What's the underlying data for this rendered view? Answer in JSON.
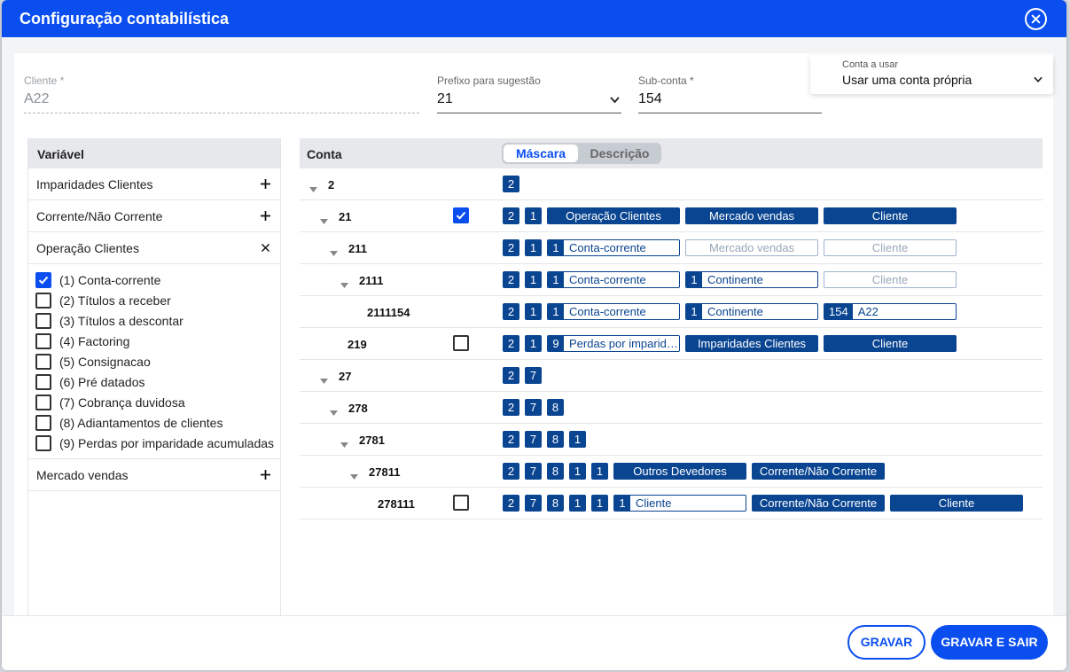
{
  "modal": {
    "title": "Configuração contabilística",
    "close_icon": "close-icon"
  },
  "form": {
    "cliente": {
      "label": "Cliente *",
      "value": "A22"
    },
    "prefixo": {
      "label": "Prefixo para sugestão",
      "value": "21"
    },
    "subconta": {
      "label": "Sub-conta *",
      "value": "154"
    },
    "conta_usar": {
      "label": "Conta a usar",
      "value": "Usar uma conta própria"
    }
  },
  "left": {
    "header": "Variável",
    "groups": [
      {
        "label": "Imparidades Clientes",
        "toggle": "+"
      },
      {
        "label": "Corrente/Não Corrente",
        "toggle": "+"
      },
      {
        "label": "Operação Clientes",
        "toggle": "×"
      },
      {
        "label": "Mercado vendas",
        "toggle": "+"
      }
    ],
    "options": [
      {
        "label": "(1) Conta-corrente",
        "checked": true
      },
      {
        "label": "(2) Títulos a receber",
        "checked": false
      },
      {
        "label": "(3) Títulos a descontar",
        "checked": false
      },
      {
        "label": "(4) Factoring",
        "checked": false
      },
      {
        "label": "(5) Consignacao",
        "checked": false
      },
      {
        "label": "(6) Pré datados",
        "checked": false
      },
      {
        "label": "(7) Cobrança duvidosa",
        "checked": false
      },
      {
        "label": "(8) Adiantamentos de clientes",
        "checked": false
      },
      {
        "label": "(9) Perdas por imparidade acumuladas",
        "checked": false
      }
    ]
  },
  "right": {
    "header": "Conta",
    "toggle": {
      "mascara": "Máscara",
      "descricao": "Descrição"
    },
    "rows": [
      {
        "code": "2",
        "digits": [
          "2"
        ],
        "tags": []
      },
      {
        "code": "21",
        "checkbox": true,
        "digits": [
          "2",
          "1"
        ],
        "tags": [
          "Operação Clientes",
          "Mercado vendas",
          "Cliente"
        ]
      },
      {
        "code": "211",
        "digits": [
          "2",
          "1"
        ],
        "inputs": [
          {
            "pre": "1",
            "text": "Conta-corrente"
          }
        ],
        "pale": [
          "Mercado vendas",
          "Cliente"
        ]
      },
      {
        "code": "2111",
        "digits": [
          "2",
          "1"
        ],
        "inputs": [
          {
            "pre": "1",
            "text": "Conta-corrente"
          },
          {
            "pre": "1",
            "text": "Continente"
          }
        ],
        "pale": [
          "Cliente"
        ]
      },
      {
        "code": "2111154",
        "digits": [
          "2",
          "1"
        ],
        "inputs": [
          {
            "pre": "1",
            "text": "Conta-corrente"
          },
          {
            "pre": "1",
            "text": "Continente"
          },
          {
            "pre": "154",
            "text": "A22"
          }
        ]
      },
      {
        "code": "219",
        "checkbox": false,
        "digits": [
          "2",
          "1"
        ],
        "inputs": [
          {
            "pre": "9",
            "text": "Perdas por imparid…"
          }
        ],
        "tags": [
          "Imparidades Clientes",
          "Cliente"
        ]
      },
      {
        "code": "27",
        "digits": [
          "2",
          "7"
        ]
      },
      {
        "code": "278",
        "digits": [
          "2",
          "7",
          "8"
        ]
      },
      {
        "code": "2781",
        "digits": [
          "2",
          "7",
          "8",
          "1"
        ]
      },
      {
        "code": "27811",
        "digits": [
          "2",
          "7",
          "8",
          "1",
          "1"
        ],
        "tags": [
          "Outros Devedores",
          "Corrente/Não Corrente"
        ]
      },
      {
        "code": "278111",
        "checkbox": false,
        "digits": [
          "2",
          "7",
          "8",
          "1",
          "1"
        ],
        "inputs": [
          {
            "pre": "1",
            "text": "Cliente"
          }
        ],
        "tags": [
          "Corrente/Não Corrente",
          "Cliente"
        ]
      }
    ]
  },
  "footer": {
    "gravar": "GRAVAR",
    "gravar_sair": "GRAVAR E SAIR"
  },
  "colors": {
    "accent": "#0a4ef0",
    "tag": "#0a4591"
  }
}
